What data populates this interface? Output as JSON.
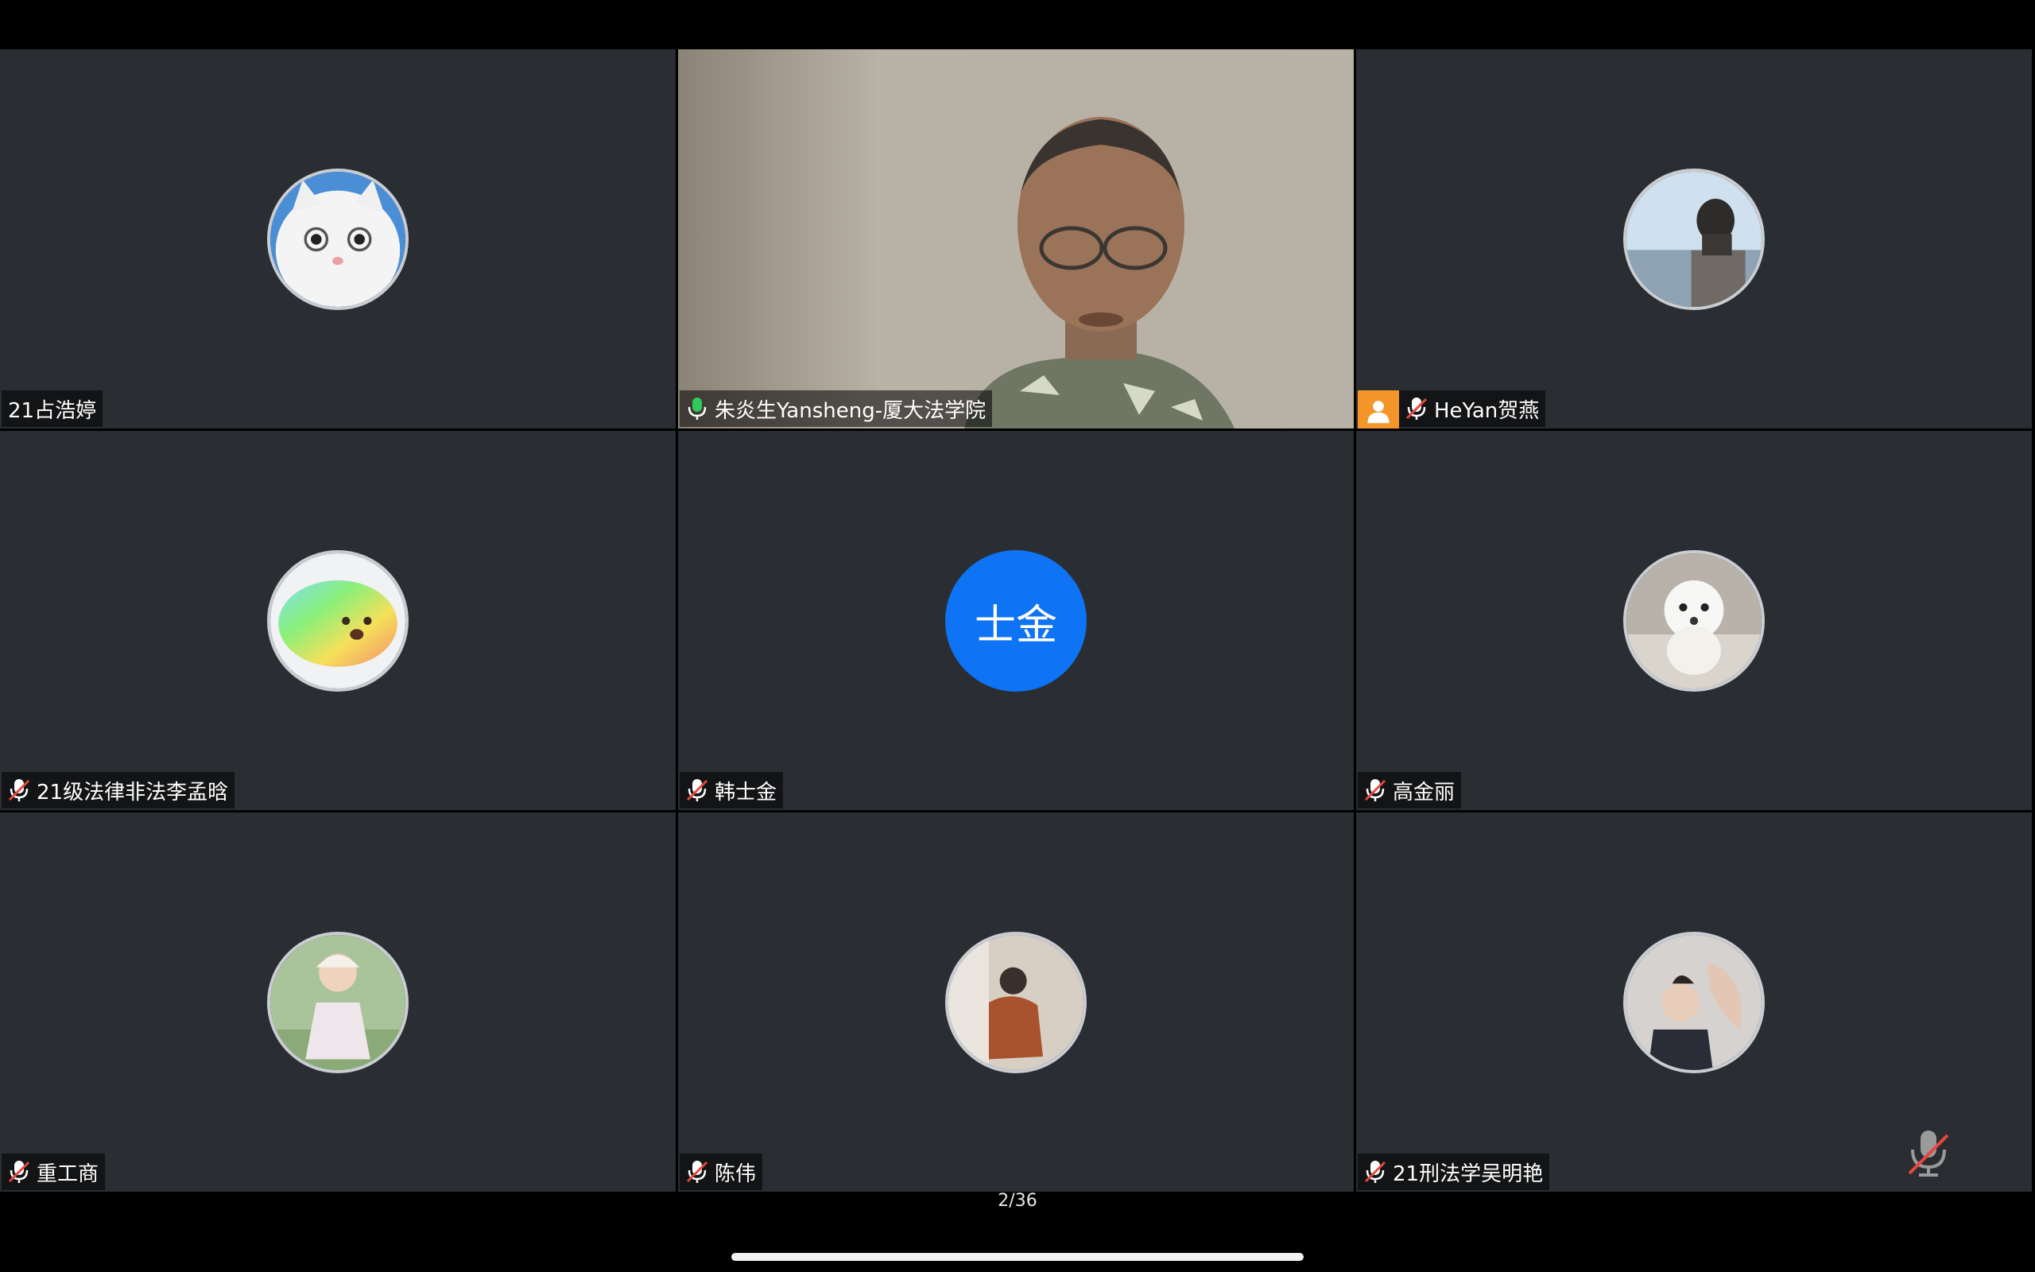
{
  "tiles": [
    {
      "name": "21占浩婷",
      "mic": "none",
      "avatar": "cat"
    },
    {
      "name": "朱炎生Yansheng-厦大法学院",
      "mic": "active",
      "avatar": "video"
    },
    {
      "name": "HeYan贺燕",
      "mic": "muted",
      "host": true,
      "avatar": "lion-statue"
    },
    {
      "name": "21级法律非法李孟晗",
      "mic": "muted",
      "avatar": "rainbow-seal"
    },
    {
      "name": "韩士金",
      "mic": "muted",
      "initials": "士金"
    },
    {
      "name": "高金丽",
      "mic": "muted",
      "avatar": "white-dog"
    },
    {
      "name": "重工商",
      "mic": "muted",
      "avatar": "child"
    },
    {
      "name": "陈伟",
      "mic": "muted",
      "avatar": "person-sitting"
    },
    {
      "name": "21刑法学吴明艳",
      "mic": "muted",
      "avatar": "hand-heart"
    }
  ],
  "page_indicator": "2/36",
  "colors": {
    "tile_bg": "#2a2d31",
    "active_speaker": "#2fca5b",
    "muted_red": "#e5483f",
    "host_badge": "#f5962a",
    "initials_bg": "#0e73f4"
  },
  "icons": [
    "mic-muted-icon",
    "mic-active-icon",
    "host-icon"
  ]
}
